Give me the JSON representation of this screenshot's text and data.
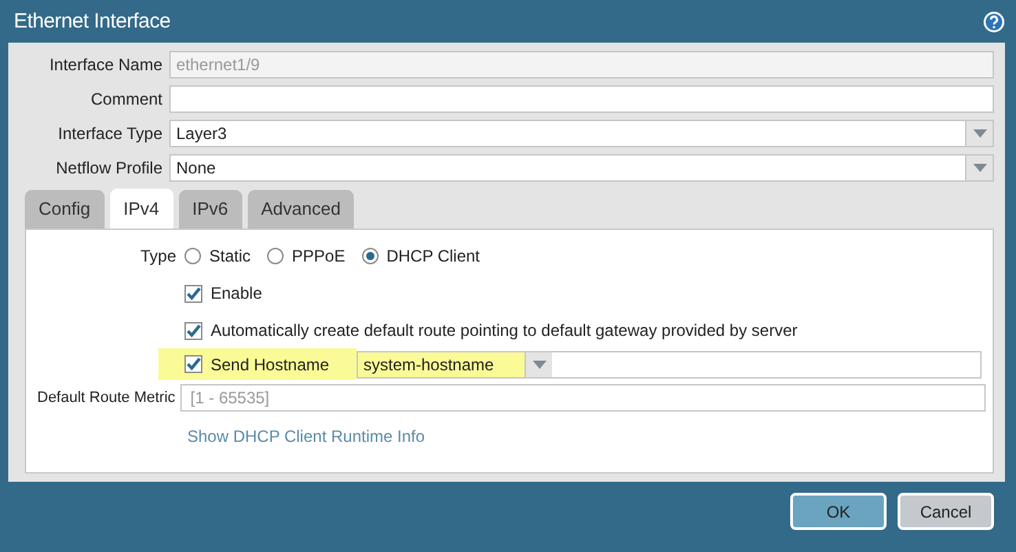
{
  "window": {
    "title": "Ethernet Interface"
  },
  "fields": [
    {
      "label": "Interface Name",
      "kind": "text",
      "value": "ethernet1/9",
      "disabled": true
    },
    {
      "label": "Comment",
      "kind": "text",
      "disabled": false
    },
    {
      "label": "Interface Type",
      "kind": "select",
      "value": "Layer3",
      "disabled": false
    },
    {
      "label": "Netflow Profile",
      "kind": "select",
      "value": "None",
      "disabled": false
    }
  ],
  "tabs": [
    {
      "label": "Config",
      "selected": false
    },
    {
      "label": "IPv4",
      "selected": true
    },
    {
      "label": "IPv6",
      "selected": false
    },
    {
      "label": "Advanced",
      "selected": false
    }
  ],
  "ipv4": {
    "type_label": "Type",
    "type_options": [
      {
        "label": "Static",
        "selected": false
      },
      {
        "label": "PPPoE",
        "selected": false
      },
      {
        "label": "DHCP Client",
        "selected": true
      }
    ],
    "options": [
      {
        "label": "Enable",
        "checked": true
      },
      {
        "label": "Automatically create default route pointing to default gateway provided by server",
        "checked": true
      }
    ],
    "send_hostname": {
      "label": "Send Hostname",
      "checked": true,
      "value": "system-hostname",
      "highlighted": true
    },
    "metric": {
      "label": "Default Route Metric",
      "placeholder": "[1 - 65535]"
    },
    "link": "Show DHCP Client Runtime Info"
  },
  "buttons": [
    {
      "label": "OK",
      "kind": "primary"
    },
    {
      "label": "Cancel",
      "kind": "secondary"
    }
  ]
}
